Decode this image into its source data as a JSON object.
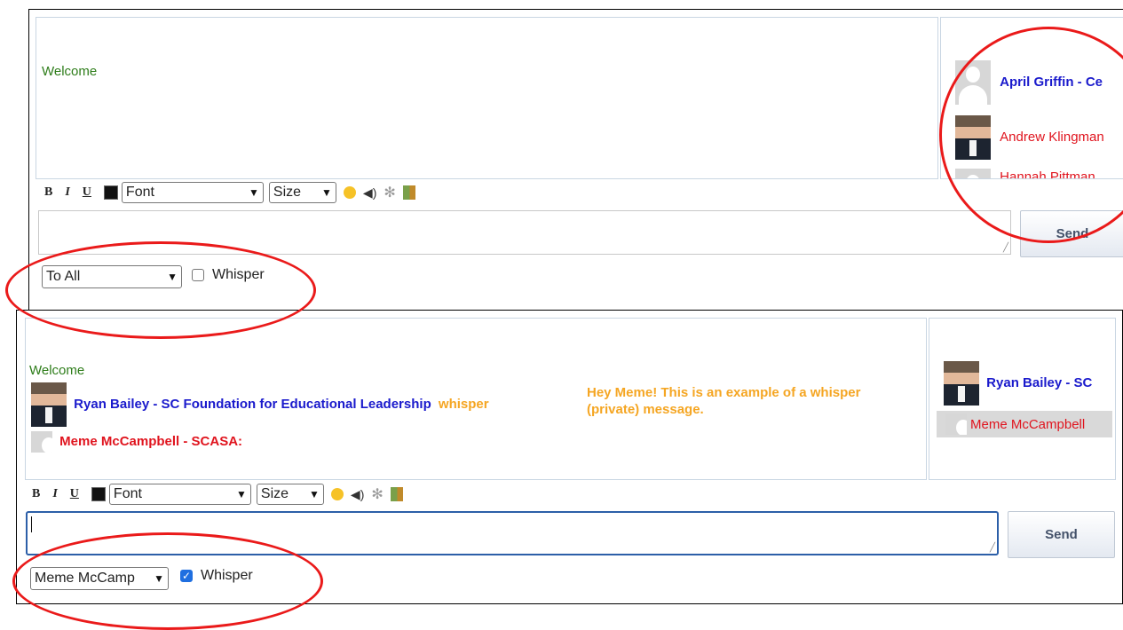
{
  "top": {
    "chat_log": [
      {
        "text": "Welcome"
      }
    ],
    "users": [
      {
        "name": "April Griffin - Ce"
      },
      {
        "name": "Andrew Klingman"
      },
      {
        "name": "Hannah Pittman"
      }
    ],
    "toolbar": {
      "bold": "B",
      "italic": "I",
      "underline": "U",
      "font": "Font",
      "size": "Size"
    },
    "send_label": "Send",
    "recipient": "To All",
    "whisper_label": "Whisper",
    "whisper_checked": false
  },
  "bottom": {
    "chat_log": {
      "welcome": "Welcome",
      "message_sender": "Ryan Bailey - SC Foundation for Educational Leadership",
      "message_type": "whisper",
      "message_text": "Hey Meme! This is an example of a whisper (private) message.",
      "reply_sender": "Meme McCampbell - SCASA:"
    },
    "users": [
      {
        "name": "Ryan Bailey - SC"
      },
      {
        "name": "Meme McCampbell"
      }
    ],
    "toolbar": {
      "bold": "B",
      "italic": "I",
      "underline": "U",
      "font": "Font",
      "size": "Size"
    },
    "send_label": "Send",
    "recipient": "Meme McCamp",
    "whisper_label": "Whisper",
    "whisper_checked": true
  },
  "colors": {
    "welcome": "#2e7d1a",
    "sender": "#1a1acc",
    "user_red": "#e0141e",
    "whisper": "#f5a623",
    "annotation_ring": "#ea1a1a",
    "active_input_border": "#2c5fa8"
  },
  "icons": [
    "color-picker-icon",
    "emoji-icon",
    "sound-icon",
    "settings-gear-icon",
    "exit-door-icon"
  ]
}
